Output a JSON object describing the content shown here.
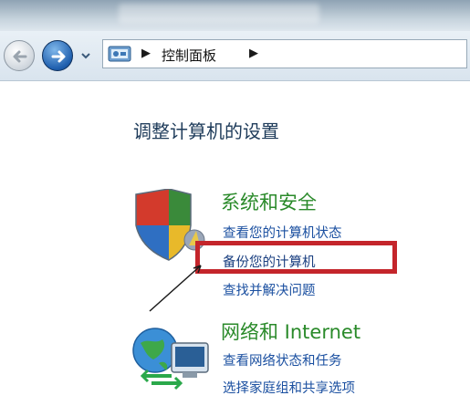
{
  "address_bar": {
    "breadcrumb": "控制面板",
    "icon": "control-panel-icon"
  },
  "main": {
    "heading": "调整计算机的设置",
    "categories": [
      {
        "title": "系统和安全",
        "icon": "shield-icon",
        "links": [
          "查看您的计算机状态",
          "备份您的计算机",
          "查找并解决问题"
        ]
      },
      {
        "title": "网络和 Internet",
        "icon": "network-globe-icon",
        "links": [
          "查看网络状态和任务",
          "选择家庭组和共享选项"
        ]
      }
    ]
  },
  "annotation": {
    "highlight_color": "#c4252b"
  }
}
